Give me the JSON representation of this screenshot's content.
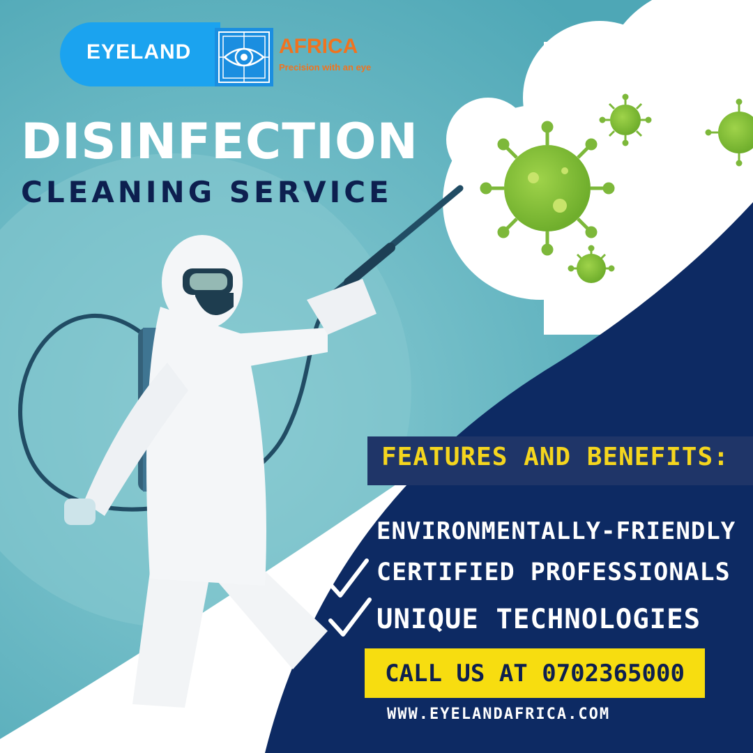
{
  "brand": {
    "name": "EYELAND",
    "region": "AFRICA",
    "tagline": "Precision with an eye"
  },
  "headline": "DISINFECTION",
  "subheadline": "CLEANING SERVICE",
  "features": {
    "title": "FEATURES AND BENEFITS:",
    "items": [
      "ENVIRONMENTALLY-FRIENDLY",
      "CERTIFIED PROFESSIONALS",
      "UNIQUE TECHNOLOGIES"
    ]
  },
  "cta": "CALL US AT 0702365000",
  "website": "WWW.EYELANDAFRICA.COM",
  "colors": {
    "teal_background": "#6fb9c3",
    "navy": "#0d2a63",
    "accent_yellow": "#f7dd10",
    "brand_blue": "#1ba3ef",
    "brand_orange": "#f0731f",
    "virus_green": "#8cc63f"
  },
  "icons": [
    "eye-logo-icon",
    "virus-icon",
    "check-icon",
    "worker-illustration"
  ]
}
